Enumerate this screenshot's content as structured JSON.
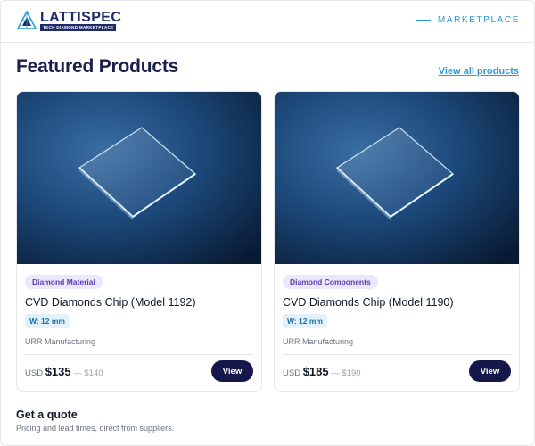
{
  "brand": {
    "name": "LATTISPEC",
    "tagline": "TECH DIAMOND MARKETPLACE",
    "color": "#1f2a6b"
  },
  "nav": {
    "section_label": "MARKETPLACE"
  },
  "featured": {
    "title": "Featured Products",
    "view_all": "View all products"
  },
  "products": [
    {
      "category": "Diamond Material",
      "name": "CVD Diamonds Chip (Model 1192)",
      "spec": "W: 12 mm",
      "supplier": "URR Manufacturing",
      "currency": "USD",
      "price_low": "$135",
      "separator": "—",
      "price_high": "$140",
      "button": "View",
      "image_icon": "diamond-chip-photo"
    },
    {
      "category": "Diamond Components",
      "name": "CVD Diamonds Chip (Model 1190)",
      "spec": "W: 12 mm",
      "supplier": "URR Manufacturing",
      "currency": "USD",
      "price_low": "$185",
      "separator": "—",
      "price_high": "$190",
      "button": "View",
      "image_icon": "diamond-chip-photo"
    }
  ],
  "quote": {
    "title": "Get a quote",
    "subtitle": "Pricing and lead times, direct from suppliers."
  },
  "colors": {
    "accent": "#2b9bd6",
    "button": "#15174a",
    "badge_text": "#5b3bb5",
    "badge_bg": "#ece7fb"
  }
}
